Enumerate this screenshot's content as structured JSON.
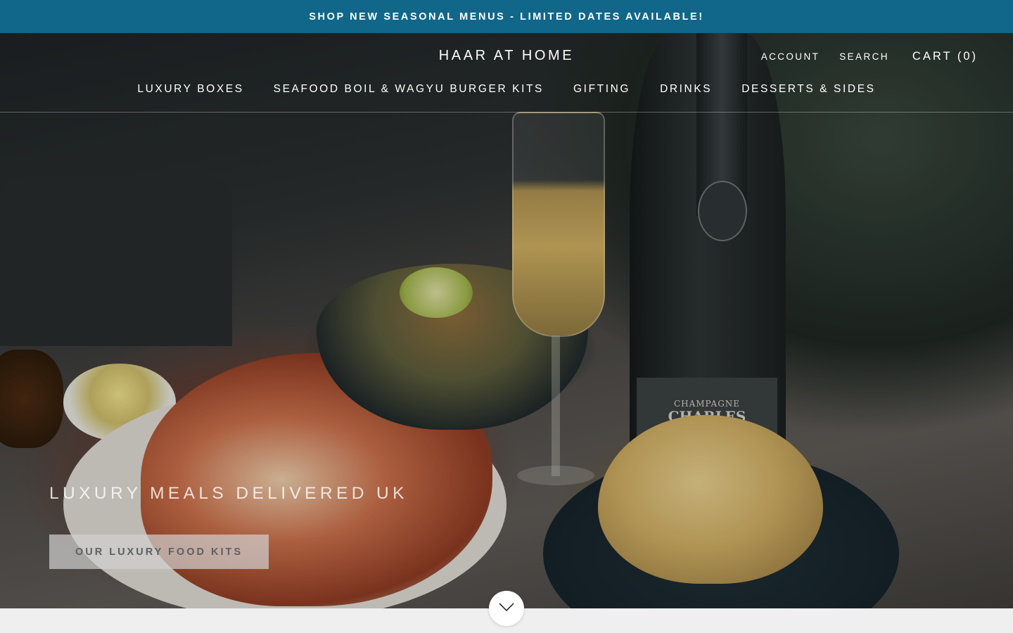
{
  "announcement": {
    "text": "SHOP NEW SEASONAL MENUS - LIMITED DATES AVAILABLE!"
  },
  "header": {
    "logo": "HAAR AT HOME",
    "account_label": "ACCOUNT",
    "search_label": "SEARCH",
    "cart_label": "CART (0)"
  },
  "nav": {
    "items": [
      {
        "label": "LUXURY BOXES"
      },
      {
        "label": "SEAFOOD BOIL & WAGYU BURGER KITS"
      },
      {
        "label": "GIFTING"
      },
      {
        "label": "DRINKS"
      },
      {
        "label": "DESSERTS & SIDES"
      }
    ]
  },
  "hero": {
    "title": "LUXURY MEALS DELIVERED UK",
    "button_label": "OUR LUXURY FOOD KITS",
    "bottle_label_top": "CHAMPAGNE",
    "bottle_label_main": "CHARLES HEIDSIECK"
  },
  "scroll": {
    "icon": "chevron-down-icon"
  },
  "colors": {
    "announcement_bg": "#10678a",
    "page_bg": "#efefef"
  }
}
